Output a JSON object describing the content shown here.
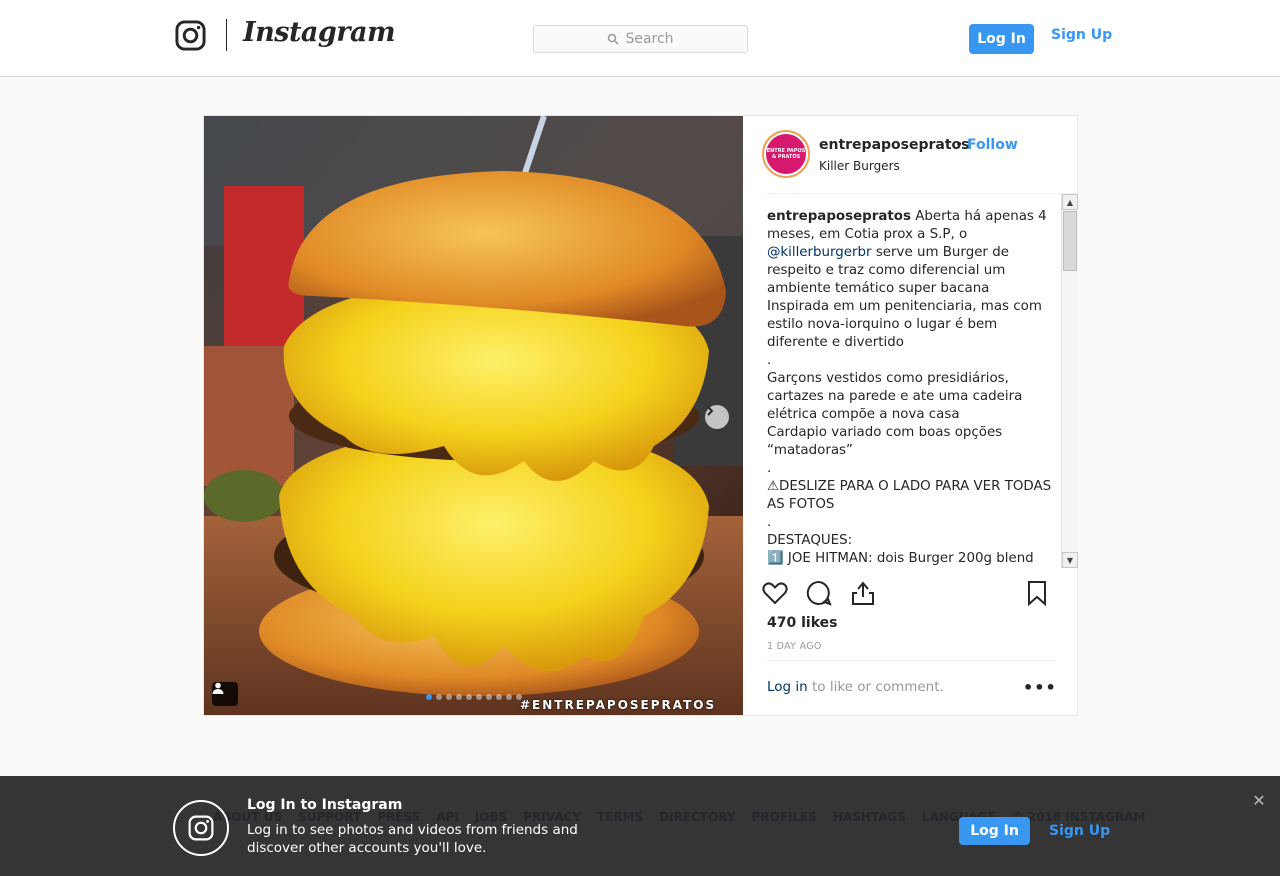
{
  "header": {
    "wordmark": "Instagram",
    "search_placeholder": "Search",
    "login_label": "Log In",
    "signup_label": "Sign Up"
  },
  "post": {
    "owner": "entrepaposepratos",
    "separator": "•",
    "follow_label": "Follow",
    "location": "Killer Burgers",
    "avatar_text": "ENTRE PAPOS & PRATOS",
    "watermark": "#ENTREPAPOSEPRATOS",
    "carousel_pages": 10,
    "carousel_active_index": 0,
    "caption": {
      "author": "entrepaposepratos",
      "intro": " Aberta há apenas 4 meses, em Cotia prox a S.P, o ",
      "mention": "@killerburgerbr",
      "lines": [
        " serve um Burger de respeito e traz como diferencial um ambiente temático super bacana",
        "Inspirada em um penitenciaria, mas com estilo nova-iorquino o lugar é bem diferente e divertido",
        ".",
        "Garçons vestidos como presidiários, cartazes na parede e ate uma cadeira elétrica compõe a nova casa",
        "Cardapio variado com boas opções “matadoras”",
        ".",
        "⚠DESLIZE PARA O LADO PARA VER TODAS AS FOTOS",
        ".",
        "DESTAQUES:",
        "1️⃣ JOE HITMAN: dois Burger 200g blend"
      ]
    },
    "likes": "470 likes",
    "time": "1 DAY AGO",
    "login_link": "Log in",
    "login_suffix": " to like or comment.",
    "more_label": "•••"
  },
  "footer_links": [
    "ABOUT US",
    "SUPPORT",
    "PRESS",
    "API",
    "JOBS",
    "PRIVACY",
    "TERMS",
    "DIRECTORY",
    "PROFILES",
    "HASHTAGS",
    "LANGUAGE",
    "© 2018 INSTAGRAM"
  ],
  "banner": {
    "title": "Log In to Instagram",
    "text": "Log in to see photos and videos from friends and discover other accounts you'll love.",
    "login_label": "Log In",
    "signup_label": "Sign Up",
    "close_label": "✕"
  },
  "colors": {
    "accent": "#3897f0",
    "link_dark": "#003569",
    "banner_bg": "#262626"
  }
}
